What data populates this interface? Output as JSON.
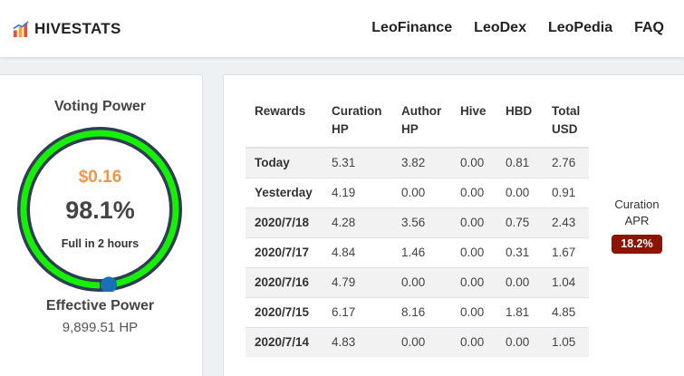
{
  "header": {
    "brand": "HIVESTATS",
    "brand_icon": "chart-logo-icon",
    "nav": [
      "LeoFinance",
      "LeoDex",
      "LeoPedia",
      "FAQ"
    ]
  },
  "voting": {
    "title": "Voting Power",
    "usd": "$0.16",
    "percent": "98.1%",
    "percent_value": 98.1,
    "full_text": "Full in 2 hours",
    "colors": {
      "ring": "#2e3e52",
      "arc": "#17ef06",
      "knob": "#1870b8",
      "usd": "#f0964b"
    }
  },
  "effective": {
    "title": "Effective Power",
    "value": "9,899.51 HP"
  },
  "rewards": {
    "headers": [
      "Rewards",
      "Curation HP",
      "Author HP",
      "Hive",
      "HBD",
      "Total USD"
    ],
    "rows": [
      [
        "Today",
        "5.31",
        "3.82",
        "0.00",
        "0.81",
        "2.76"
      ],
      [
        "Yesterday",
        "4.19",
        "0.00",
        "0.00",
        "0.00",
        "0.91"
      ],
      [
        "2020/7/18",
        "4.28",
        "3.56",
        "0.00",
        "0.75",
        "2.43"
      ],
      [
        "2020/7/17",
        "4.84",
        "1.46",
        "0.00",
        "0.31",
        "1.67"
      ],
      [
        "2020/7/16",
        "4.79",
        "0.00",
        "0.00",
        "0.00",
        "1.04"
      ],
      [
        "2020/7/15",
        "6.17",
        "8.16",
        "0.00",
        "1.81",
        "4.85"
      ],
      [
        "2020/7/14",
        "4.83",
        "0.00",
        "0.00",
        "0.00",
        "1.05"
      ]
    ]
  },
  "apr": {
    "label": "Curation APR",
    "value": "18.2%",
    "badge_color": "#8c1405"
  }
}
